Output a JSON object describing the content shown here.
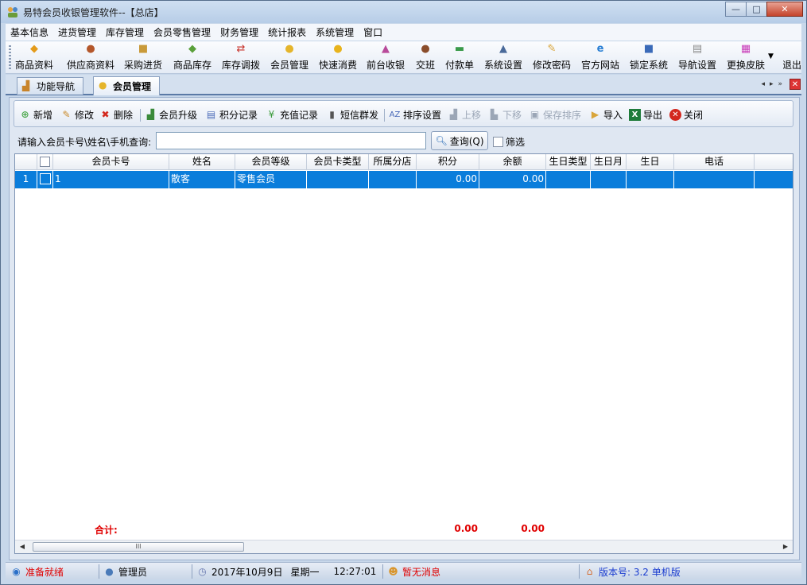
{
  "window": {
    "title": "易特会员收银管理软件--【总店】",
    "controls": {
      "minimize": "—",
      "maximize": "□",
      "close": "✕"
    }
  },
  "menu": [
    "基本信息",
    "进货管理",
    "库存管理",
    "会员零售管理",
    "财务管理",
    "统计报表",
    "系统管理",
    "窗口"
  ],
  "toolbar": {
    "items": [
      {
        "label": "商品资料",
        "icon": "product-icon"
      },
      {
        "label": "供应商资料",
        "icon": "supplier-icon"
      },
      {
        "label": "采购进货",
        "icon": "truck-icon"
      },
      {
        "label": "商品库存",
        "icon": "box-icon"
      },
      {
        "label": "库存调拨",
        "icon": "transfer-icon"
      },
      {
        "label": "会员管理",
        "icon": "member-icon"
      },
      {
        "label": "快速消费",
        "icon": "coin-icon"
      },
      {
        "label": "前台收银",
        "icon": "cashier-icon"
      },
      {
        "label": "交班",
        "icon": "shift-icon"
      },
      {
        "label": "付款单",
        "icon": "payment-icon"
      },
      {
        "label": "系统设置",
        "icon": "settings-icon"
      },
      {
        "label": "修改密码",
        "icon": "pencil-icon"
      },
      {
        "label": "官方网站",
        "icon": "ie-icon"
      },
      {
        "label": "锁定系统",
        "icon": "lock-icon"
      },
      {
        "label": "导航设置",
        "icon": "nav-icon"
      },
      {
        "label": "更换皮肤",
        "icon": "skin-icon"
      },
      {
        "label": "退出",
        "icon": "exit-icon"
      }
    ]
  },
  "tabs": [
    {
      "label": "功能导航",
      "active": false
    },
    {
      "label": "会员管理",
      "active": true
    }
  ],
  "inner_toolbar": {
    "add": "新增",
    "edit": "修改",
    "delete": "删除",
    "upgrade": "会员升级",
    "points_log": "积分记录",
    "recharge_log": "充值记录",
    "sms": "短信群发",
    "sort_settings": "排序设置",
    "move_up": "上移",
    "move_down": "下移",
    "save_sort": "保存排序",
    "import": "导入",
    "export": "导出",
    "close": "关闭"
  },
  "search": {
    "label": "请输入会员卡号\\姓名\\手机查询:",
    "value": "",
    "query_button": "查询(Q)",
    "filter_label": "筛选"
  },
  "grid": {
    "columns": [
      "",
      "",
      "会员卡号",
      "姓名",
      "会员等级",
      "会员卡类型",
      "所属分店",
      "积分",
      "余额",
      "生日类型",
      "生日月",
      "生日",
      "电话"
    ],
    "rows": [
      {
        "index": "1",
        "card_no": "1",
        "name": "散客",
        "level": "零售会员",
        "card_type": "",
        "branch": "",
        "points": "0.00",
        "balance": "0.00",
        "birthday_type": "",
        "birth_month": "",
        "birthday": "",
        "phone": ""
      }
    ],
    "total_label": "合计:",
    "total_points": "0.00",
    "total_balance": "0.00",
    "scroll_thumb": "III"
  },
  "status": {
    "state": "准备就绪",
    "user": "管理员",
    "date": "2017年10月9日",
    "weekday": "星期一",
    "time": "12:27:01",
    "message": "暂无消息",
    "version": "版本号: 3.2 单机版"
  },
  "colors": {
    "selected_row": "#0a7ddb",
    "total_red": "#e00000",
    "status_red": "#e00000",
    "version_blue": "#1a3ccf"
  }
}
